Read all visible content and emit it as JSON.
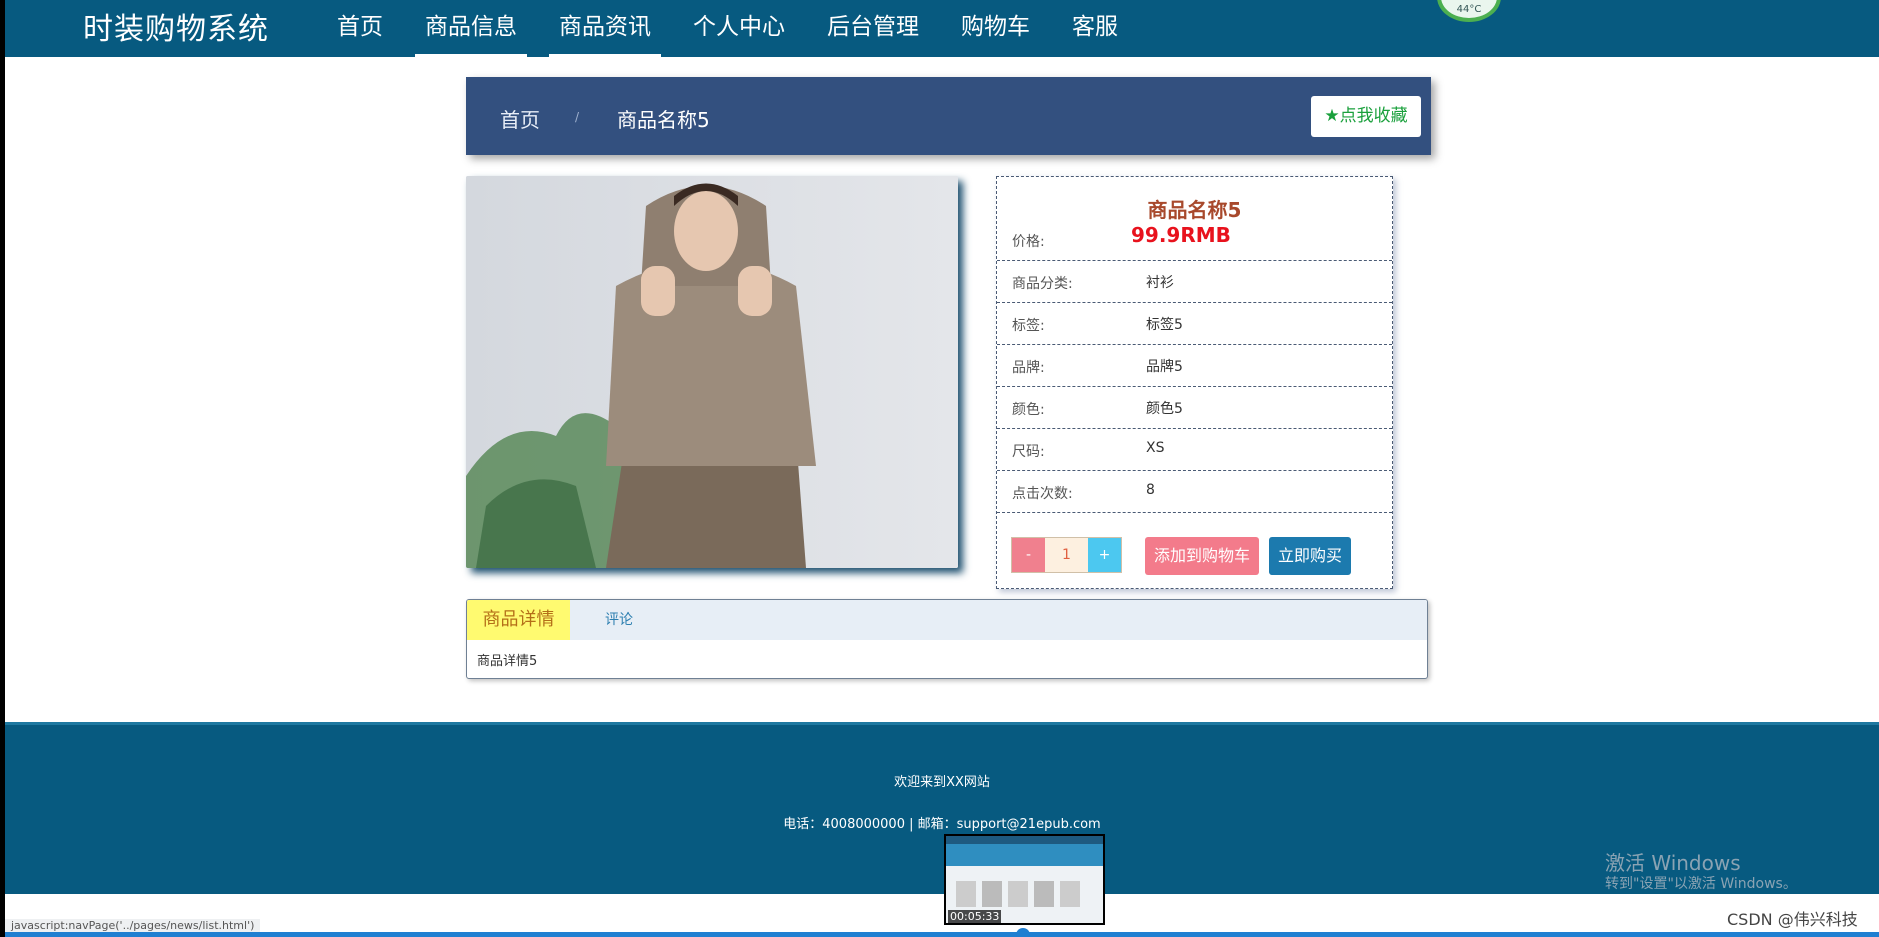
{
  "header": {
    "logo": "时装购物系统",
    "nav": [
      {
        "label": "首页"
      },
      {
        "label": "商品信息"
      },
      {
        "label": "商品资讯"
      },
      {
        "label": "个人中心"
      },
      {
        "label": "后台管理"
      },
      {
        "label": "购物车"
      },
      {
        "label": "客服"
      }
    ],
    "active_nav": "商品信息",
    "weather_text": "44°C"
  },
  "breadcrumb": {
    "home": "首页",
    "separator": "/",
    "current": "商品名称5",
    "favorite_label": "点我收藏",
    "favorite_icon": "star-icon"
  },
  "product": {
    "title": "商品名称5",
    "price_label": "价格:",
    "price_value": "99.9RMB",
    "attributes": [
      {
        "label": "商品分类:",
        "value": "衬衫"
      },
      {
        "label": "标签:",
        "value": "标签5"
      },
      {
        "label": "品牌:",
        "value": "品牌5"
      },
      {
        "label": "颜色:",
        "value": "颜色5"
      },
      {
        "label": "尺码:",
        "value": "XS"
      },
      {
        "label": "点击次数:",
        "value": "8"
      }
    ],
    "quantity": "1",
    "minus_label": "-",
    "plus_label": "+",
    "add_to_cart_label": "添加到购物车",
    "buy_now_label": "立即购买"
  },
  "tabs": {
    "items": [
      {
        "label": "商品详情"
      },
      {
        "label": "评论"
      }
    ],
    "content": "商品详情5"
  },
  "footer": {
    "welcome": "欢迎来到XX网站",
    "contact": "电话：4008000000 | 邮箱：support@21epub.com"
  },
  "overlay": {
    "windows_title": "激活 Windows",
    "windows_sub": "转到\"设置\"以激活 Windows。",
    "video_time": "00:05:33",
    "status_url": "javascript:navPage('../pages/news/list.html')",
    "watermark": "CSDN @伟兴科技"
  },
  "colors": {
    "header_bg": "#075a80",
    "breadcrumb_bg": "#33507f",
    "price": "#e8121d",
    "title": "#a8492c"
  }
}
